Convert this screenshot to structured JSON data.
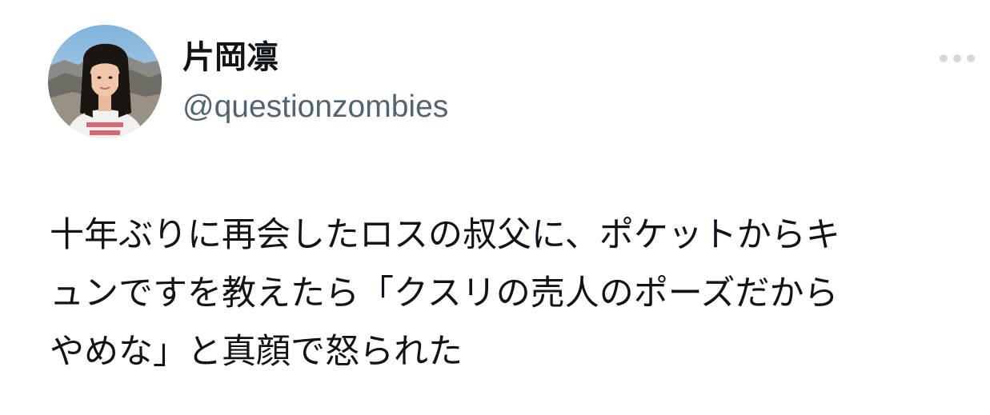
{
  "author": {
    "display_name": "片岡凛",
    "handle": "@questionzombies",
    "avatar_icon": "user-avatar-photo"
  },
  "tweet": {
    "text_lines": [
      "十年ぶりに再会したロスの叔父に、ポケットからキ",
      "ュンですを教えたら「クスリの売人のポーズだから",
      "やめな」と真顔で怒られた"
    ]
  },
  "actions": {
    "more_icon": "more-options-icon"
  },
  "colors": {
    "text_primary": "#0f1419",
    "text_secondary": "#536471",
    "more_icon": "#cfd9de",
    "background": "#ffffff"
  }
}
